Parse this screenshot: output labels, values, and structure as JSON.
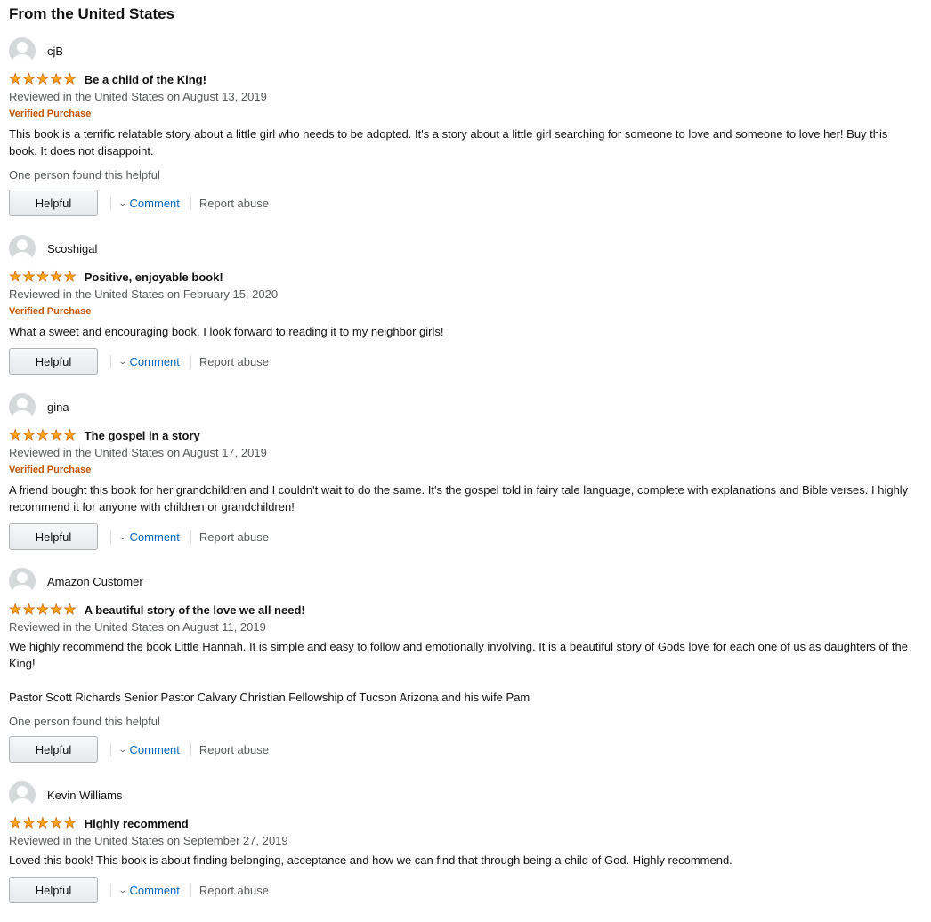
{
  "section_title": "From the United States",
  "reviews": [
    {
      "username": "cjB",
      "rating": 5,
      "title": "Be a child of the King!",
      "date": "Reviewed in the United States on August 13, 2019",
      "verified": "Verified Purchase",
      "body": [
        "This book is a terrific relatable story about a little girl who needs to be adopted. It's a story about a little girl searching for someone to love and someone to love her! Buy this book. It does not disappoint."
      ],
      "helpful_count": "One person found this helpful",
      "helpful_label": "Helpful",
      "comment_label": "Comment",
      "report_label": "Report abuse"
    },
    {
      "username": "Scoshigal",
      "rating": 5,
      "title": "Positive, enjoyable book!",
      "date": "Reviewed in the United States on February 15, 2020",
      "verified": "Verified Purchase",
      "body": [
        "What a sweet and encouraging book. I look forward to reading it to my neighbor girls!"
      ],
      "helpful_count": "",
      "helpful_label": "Helpful",
      "comment_label": "Comment",
      "report_label": "Report abuse"
    },
    {
      "username": "gina",
      "rating": 5,
      "title": "The gospel in a story",
      "date": "Reviewed in the United States on August 17, 2019",
      "verified": "Verified Purchase",
      "body": [
        "A friend bought this book for her grandchildren and I couldn't wait to do the same. It's the gospel told in fairy tale language, complete with explanations and Bible verses. I highly recommend it for anyone with children or grandchildren!"
      ],
      "helpful_count": "",
      "helpful_label": "Helpful",
      "comment_label": "Comment",
      "report_label": "Report abuse"
    },
    {
      "username": "Amazon Customer",
      "rating": 5,
      "title": "A beautiful story of the love we all need!",
      "date": "Reviewed in the United States on August 11, 2019",
      "verified": "",
      "body": [
        "We highly recommend the book Little Hannah. It is simple and easy to follow and emotionally involving. It is a beautiful story of Gods love for each one of us as daughters of the King!",
        "Pastor Scott Richards Senior Pastor Calvary Christian Fellowship of Tucson Arizona and his wife Pam"
      ],
      "helpful_count": "One person found this helpful",
      "helpful_label": "Helpful",
      "comment_label": "Comment",
      "report_label": "Report abuse"
    },
    {
      "username": "Kevin Williams",
      "rating": 5,
      "title": "Highly recommend",
      "date": "Reviewed in the United States on September 27, 2019",
      "verified": "",
      "body": [
        "Loved this book! This book is about finding belonging, acceptance and how we can find that through being a child of God. Highly recommend."
      ],
      "helpful_count": "",
      "helpful_label": "Helpful",
      "comment_label": "Comment",
      "report_label": "Report abuse"
    }
  ],
  "colors": {
    "star": "#ffa41c",
    "verified": "#c45500",
    "link": "#0066c0",
    "muted": "#565959"
  },
  "icons": {
    "avatar": "default-profile-avatar-icon",
    "star": "star-icon",
    "chevron": "chevron-down-icon"
  }
}
